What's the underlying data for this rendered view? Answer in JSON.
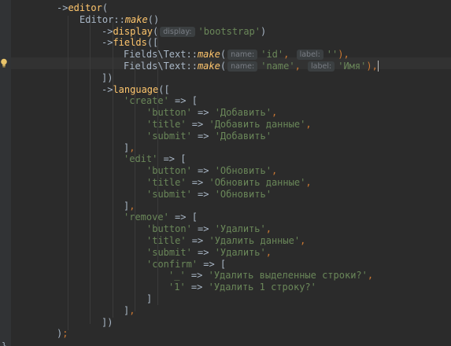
{
  "editor": {
    "colors": {
      "background": "#2b2b2b",
      "current_line": "#323232",
      "method": "#ffc66d",
      "string": "#6a8759",
      "punctuation": "#cc7832",
      "plain": "#a9b7c6",
      "hint_text": "#7a7e85",
      "hint_bg": "#3b3f41"
    },
    "gutter_icon": "lightbulb-icon",
    "lines": [
      {
        "indent": 72,
        "tokens": [
          {
            "t": "->",
            "c": "arrow"
          },
          {
            "t": "editor",
            "c": "method"
          },
          {
            "t": "(",
            "c": "cls"
          }
        ]
      },
      {
        "indent": 101,
        "tokens": [
          {
            "t": "Editor",
            "c": "cls"
          },
          {
            "t": "::",
            "c": "cls"
          },
          {
            "t": "make",
            "c": "static-call"
          },
          {
            "t": "()",
            "c": "cls"
          }
        ]
      },
      {
        "indent": 129,
        "tokens": [
          {
            "t": "->",
            "c": "arrow"
          },
          {
            "t": "display",
            "c": "method"
          },
          {
            "t": "(",
            "c": "cls"
          },
          {
            "t": "display:",
            "c": "hint"
          },
          {
            "t": "'bootstrap'",
            "c": "str"
          },
          {
            "t": ")",
            "c": "cls"
          }
        ]
      },
      {
        "indent": 129,
        "tokens": [
          {
            "t": "->",
            "c": "arrow"
          },
          {
            "t": "fields",
            "c": "method"
          },
          {
            "t": "([",
            "c": "cls"
          }
        ]
      },
      {
        "indent": 157,
        "tokens": [
          {
            "t": "Fields\\Text",
            "c": "cls"
          },
          {
            "t": "::",
            "c": "cls"
          },
          {
            "t": "make",
            "c": "static-call"
          },
          {
            "t": "(",
            "c": "cls"
          },
          {
            "t": "name:",
            "c": "hint"
          },
          {
            "t": "'id'",
            "c": "str"
          },
          {
            "t": ", ",
            "c": "punc"
          },
          {
            "t": "label:",
            "c": "hint"
          },
          {
            "t": "''",
            "c": "str"
          },
          {
            "t": "),",
            "c": "punc"
          }
        ]
      },
      {
        "indent": 157,
        "current": true,
        "tokens": [
          {
            "t": "Fields\\Text",
            "c": "cls"
          },
          {
            "t": "::",
            "c": "cls"
          },
          {
            "t": "make",
            "c": "static-call"
          },
          {
            "t": "(",
            "c": "cls"
          },
          {
            "t": "name:",
            "c": "hint"
          },
          {
            "t": "'name'",
            "c": "str"
          },
          {
            "t": ", ",
            "c": "punc"
          },
          {
            "t": "label:",
            "c": "hint"
          },
          {
            "t": "'Имя'",
            "c": "str"
          },
          {
            "t": "),",
            "c": "punc"
          },
          {
            "t": "",
            "c": "caret"
          }
        ]
      },
      {
        "indent": 129,
        "tokens": [
          {
            "t": "])",
            "c": "cls"
          }
        ]
      },
      {
        "indent": 129,
        "tokens": [
          {
            "t": "->",
            "c": "arrow"
          },
          {
            "t": "language",
            "c": "method"
          },
          {
            "t": "([",
            "c": "cls"
          }
        ]
      },
      {
        "indent": 157,
        "tokens": [
          {
            "t": "'create'",
            "c": "str"
          },
          {
            "t": " => [",
            "c": "cls"
          }
        ]
      },
      {
        "indent": 186,
        "tokens": [
          {
            "t": "'button'",
            "c": "str"
          },
          {
            "t": " => ",
            "c": "cls"
          },
          {
            "t": "'Добавить'",
            "c": "str"
          },
          {
            "t": ",",
            "c": "punc"
          }
        ]
      },
      {
        "indent": 186,
        "tokens": [
          {
            "t": "'title'",
            "c": "str"
          },
          {
            "t": " => ",
            "c": "cls"
          },
          {
            "t": "'Добавить данные'",
            "c": "str"
          },
          {
            "t": ",",
            "c": "punc"
          }
        ]
      },
      {
        "indent": 186,
        "tokens": [
          {
            "t": "'submit'",
            "c": "str"
          },
          {
            "t": " => ",
            "c": "cls"
          },
          {
            "t": "'Добавить'",
            "c": "str"
          }
        ]
      },
      {
        "indent": 157,
        "tokens": [
          {
            "t": "]",
            "c": "cls"
          },
          {
            "t": ",",
            "c": "punc"
          }
        ]
      },
      {
        "indent": 157,
        "tokens": [
          {
            "t": "'edit'",
            "c": "str"
          },
          {
            "t": " => [",
            "c": "cls"
          }
        ]
      },
      {
        "indent": 186,
        "tokens": [
          {
            "t": "'button'",
            "c": "str"
          },
          {
            "t": " => ",
            "c": "cls"
          },
          {
            "t": "'Обновить'",
            "c": "str"
          },
          {
            "t": ",",
            "c": "punc"
          }
        ]
      },
      {
        "indent": 186,
        "tokens": [
          {
            "t": "'title'",
            "c": "str"
          },
          {
            "t": " => ",
            "c": "cls"
          },
          {
            "t": "'Обновить данные'",
            "c": "str"
          },
          {
            "t": ",",
            "c": "punc"
          }
        ]
      },
      {
        "indent": 186,
        "tokens": [
          {
            "t": "'submit'",
            "c": "str"
          },
          {
            "t": " => ",
            "c": "cls"
          },
          {
            "t": "'Обновить'",
            "c": "str"
          }
        ]
      },
      {
        "indent": 157,
        "tokens": [
          {
            "t": "]",
            "c": "cls"
          },
          {
            "t": ",",
            "c": "punc"
          }
        ]
      },
      {
        "indent": 157,
        "tokens": [
          {
            "t": "'remove'",
            "c": "str"
          },
          {
            "t": " => [",
            "c": "cls"
          }
        ]
      },
      {
        "indent": 186,
        "tokens": [
          {
            "t": "'button'",
            "c": "str"
          },
          {
            "t": " => ",
            "c": "cls"
          },
          {
            "t": "'Удалить'",
            "c": "str"
          },
          {
            "t": ",",
            "c": "punc"
          }
        ]
      },
      {
        "indent": 186,
        "tokens": [
          {
            "t": "'title'",
            "c": "str"
          },
          {
            "t": " => ",
            "c": "cls"
          },
          {
            "t": "'Удалить данные'",
            "c": "str"
          },
          {
            "t": ",",
            "c": "punc"
          }
        ]
      },
      {
        "indent": 186,
        "tokens": [
          {
            "t": "'submit'",
            "c": "str"
          },
          {
            "t": " => ",
            "c": "cls"
          },
          {
            "t": "'Удалить'",
            "c": "str"
          },
          {
            "t": ",",
            "c": "punc"
          }
        ]
      },
      {
        "indent": 186,
        "tokens": [
          {
            "t": "'confirm'",
            "c": "str"
          },
          {
            "t": " => [",
            "c": "cls"
          }
        ]
      },
      {
        "indent": 214,
        "tokens": [
          {
            "t": "'_'",
            "c": "str"
          },
          {
            "t": " => ",
            "c": "cls"
          },
          {
            "t": "'Удалить выделенные строки?'",
            "c": "str"
          },
          {
            "t": ",",
            "c": "punc"
          }
        ]
      },
      {
        "indent": 214,
        "tokens": [
          {
            "t": "'1'",
            "c": "str"
          },
          {
            "t": " => ",
            "c": "cls"
          },
          {
            "t": "'Удалить 1 строку?'",
            "c": "str"
          }
        ]
      },
      {
        "indent": 186,
        "tokens": [
          {
            "t": "]",
            "c": "cls"
          }
        ]
      },
      {
        "indent": 157,
        "tokens": [
          {
            "t": "]",
            "c": "cls"
          },
          {
            "t": ",",
            "c": "punc"
          }
        ]
      },
      {
        "indent": 129,
        "tokens": [
          {
            "t": "])",
            "c": "cls"
          }
        ]
      },
      {
        "indent": 72,
        "tokens": [
          {
            "t": ")",
            "c": "cls"
          },
          {
            "t": ";",
            "c": "punc"
          }
        ]
      }
    ],
    "fold_marker": "}"
  }
}
